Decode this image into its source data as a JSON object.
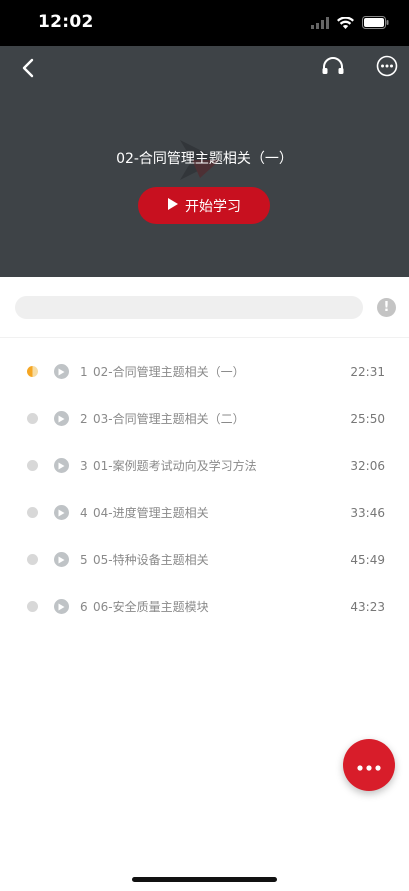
{
  "status_bar": {
    "time": "12:02"
  },
  "hero": {
    "title": "02-合同管理主题相关（一）",
    "start_label": "开始学习"
  },
  "progress": {
    "fraction": 0.0
  },
  "lessons": [
    {
      "num": "1",
      "title": "02-合同管理主题相关（一）",
      "duration": "22:31",
      "state": "in-progress"
    },
    {
      "num": "2",
      "title": "03-合同管理主题相关（二）",
      "duration": "25:50",
      "state": "not-started"
    },
    {
      "num": "3",
      "title": "01-案例题考试动向及学习方法",
      "duration": "32:06",
      "state": "not-started"
    },
    {
      "num": "4",
      "title": "04-进度管理主题相关",
      "duration": "33:46",
      "state": "not-started"
    },
    {
      "num": "5",
      "title": "05-特种设备主题相关",
      "duration": "45:49",
      "state": "not-started"
    },
    {
      "num": "6",
      "title": "06-安全质量主题模块",
      "duration": "43:23",
      "state": "not-started"
    }
  ],
  "colors": {
    "accent": "#c8101f",
    "hero_bg": "#3e4347",
    "in_progress_dot": "#f5a623"
  },
  "icons": {
    "back": "chevron-left-icon",
    "audio": "headphones-icon",
    "more": "more-circle-icon",
    "info": "info-icon",
    "play": "play-icon",
    "fab": "ellipsis-icon"
  }
}
